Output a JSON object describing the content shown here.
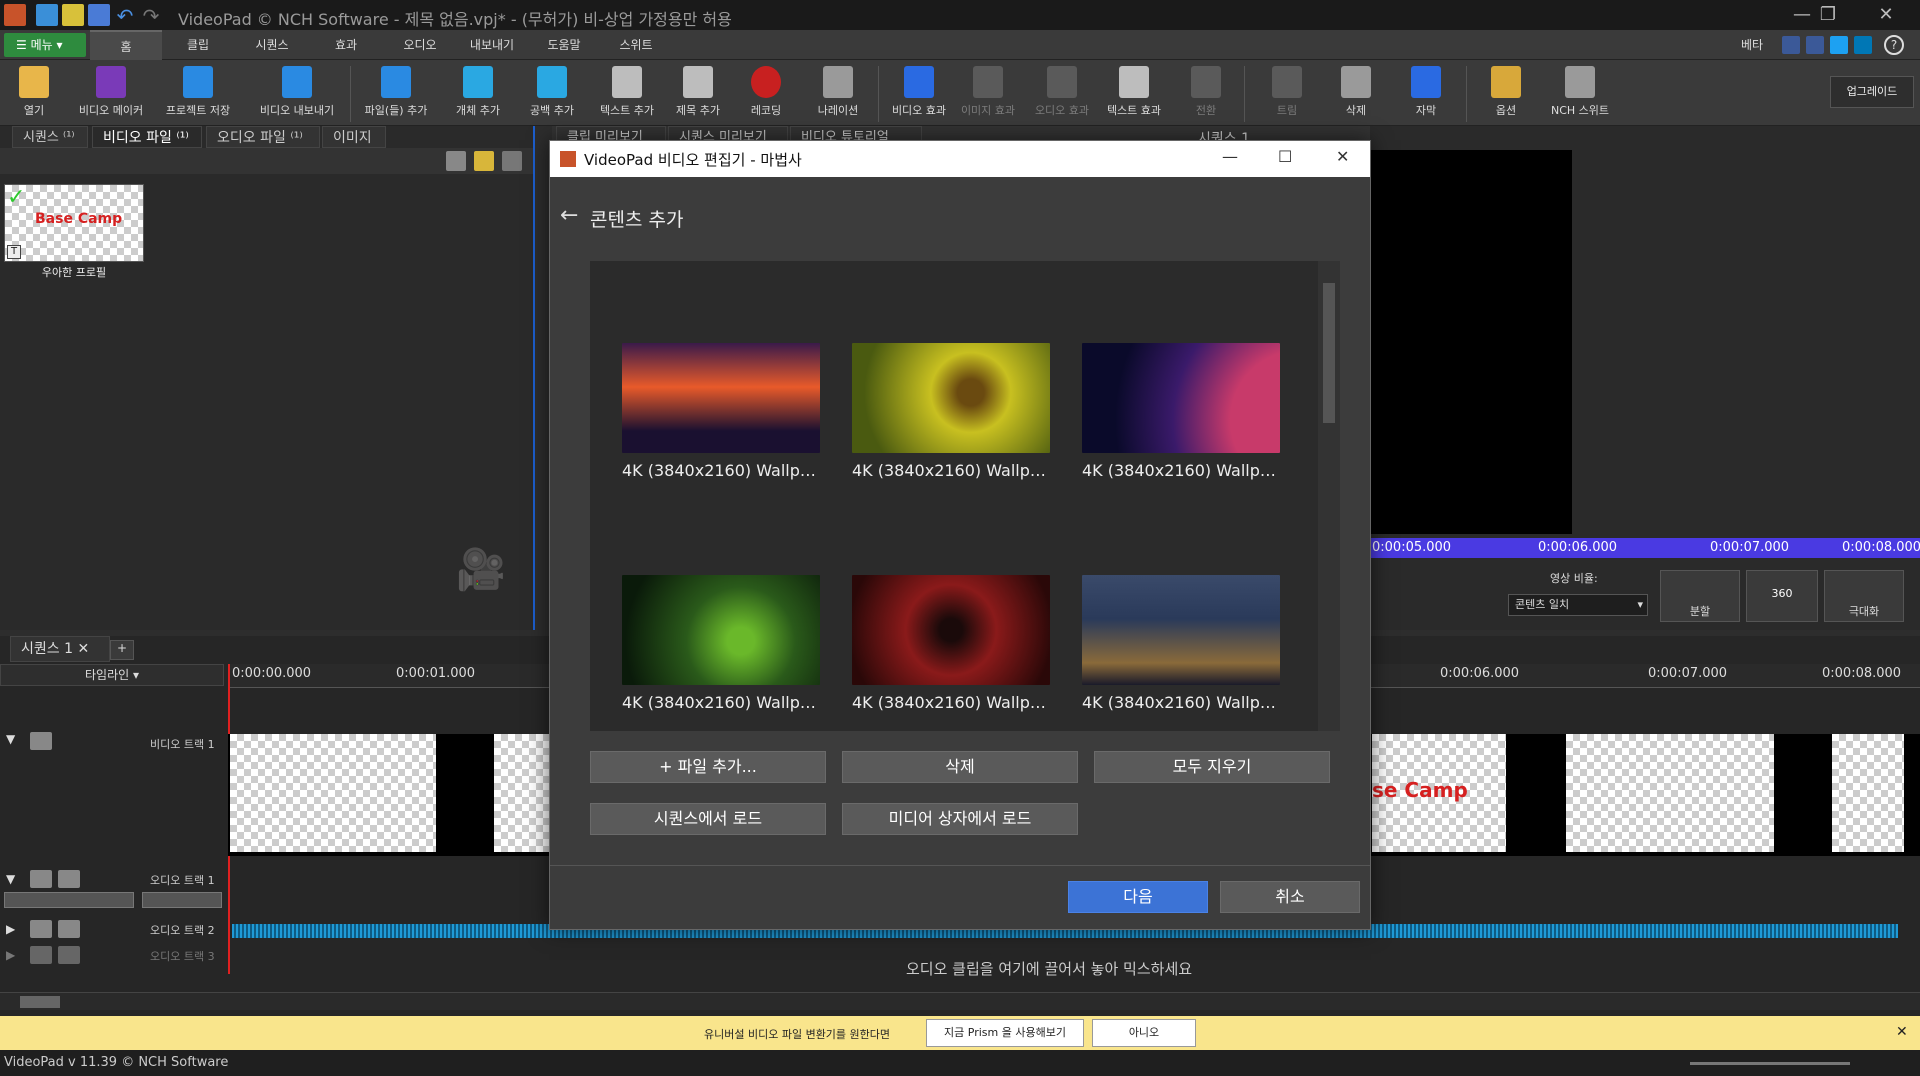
{
  "window": {
    "title": "VideoPad © NCH Software - 제목 없음.vpj* - (무허가) 비-상업 가정용만 허용",
    "minimize": "—",
    "restore": "❐",
    "close": "✕"
  },
  "tabs": {
    "menu": "메뉴",
    "items": [
      "홈",
      "클립",
      "시퀀스",
      "효과",
      "오디오",
      "내보내기",
      "도움말",
      "스위트"
    ],
    "beta": "베타"
  },
  "toolbar": {
    "items": [
      {
        "label": "열기",
        "icon": "open-folder-icon"
      },
      {
        "label": "비디오 메이커",
        "icon": "wizard-icon"
      },
      {
        "label": "프로젝트 저장",
        "icon": "save-icon"
      },
      {
        "label": "비디오 내보내기",
        "icon": "export-icon"
      },
      {
        "label": "파일(들) 추가",
        "icon": "add-files-icon"
      },
      {
        "label": "개체 추가",
        "icon": "add-object-icon"
      },
      {
        "label": "공백 추가",
        "icon": "add-blank-icon"
      },
      {
        "label": "텍스트 추가",
        "icon": "add-text-icon"
      },
      {
        "label": "제목 추가",
        "icon": "add-title-icon"
      },
      {
        "label": "레코딩",
        "icon": "record-icon"
      },
      {
        "label": "나레이션",
        "icon": "microphone-icon"
      },
      {
        "label": "비디오 효과",
        "icon": "video-fx-icon"
      },
      {
        "label": "이미지 효과",
        "icon": "image-fx-icon"
      },
      {
        "label": "오디오 효과",
        "icon": "audio-fx-icon"
      },
      {
        "label": "텍스트 효과",
        "icon": "text-fx-icon"
      },
      {
        "label": "전환",
        "icon": "transition-icon"
      },
      {
        "label": "트림",
        "icon": "trim-icon"
      },
      {
        "label": "삭제",
        "icon": "trash-icon"
      },
      {
        "label": "자막",
        "icon": "subtitle-icon"
      },
      {
        "label": "옵션",
        "icon": "options-icon"
      },
      {
        "label": "NCH 스위트",
        "icon": "nch-suite-icon"
      }
    ],
    "upgrade": "업그레이드"
  },
  "left_panel": {
    "tabs": [
      "시퀀스",
      "비디오 파일",
      "오디오 파일",
      "이미지"
    ],
    "tab_badges": [
      "⁽¹⁾",
      "⁽¹⁾",
      "⁽¹⁾",
      ""
    ],
    "clip_name": "우아한 프로필",
    "clip_logo": "Base Camp"
  },
  "preview_tabs": [
    "클립 미리보기",
    "시퀀스 미리보기",
    "비디오 튜토리얼"
  ],
  "sequence_label": "시퀀스 1",
  "preview": {
    "times": [
      "0:00:05.000",
      "0:00:06.000",
      "0:00:07.000",
      "0:00:08.000"
    ],
    "ratio_label": "영상 비율:",
    "ratio_value": "콘텐츠 일치",
    "split": "분할",
    "btn360": "360",
    "zoom": "극대화"
  },
  "dialog": {
    "title": "VideoPad 비디오 편집기 - 마법사",
    "heading": "콘텐츠 추가",
    "thumbs": [
      {
        "caption": "4K (3840x2160) Wallpape...",
        "color": "sunset"
      },
      {
        "caption": "4K (3840x2160) Wallpape...",
        "color": "bee"
      },
      {
        "caption": "4K (3840x2160) Wallpape...",
        "color": "space"
      },
      {
        "caption": "4K (3840x2160) Wallpape...",
        "color": "lizard"
      },
      {
        "caption": "4K (3840x2160) Wallpape...",
        "color": "spider"
      },
      {
        "caption": "4K (3840x2160) Wallpape...",
        "color": "city"
      }
    ],
    "buttons": {
      "add_file": "+ 파일 추가...",
      "delete": "삭제",
      "clear_all": "모두 지우기",
      "load_seq": "시퀀스에서 로드",
      "load_media": "미디어 상자에서 로드",
      "next": "다음",
      "cancel": "취소"
    }
  },
  "timeline": {
    "seq_tab": "시퀀스 1",
    "mode": "타임라인",
    "ruler": [
      "0:00:00.000",
      "0:00:01.000",
      "0:00:06.000",
      "0:00:07.000",
      "0:00:08.000"
    ],
    "tracks": {
      "video1": "비디오 트랙 1",
      "audio1": "오디오 트랙 1",
      "audio2": "오디오 트랙 2",
      "audio3": "오디오 트랙 3"
    },
    "drop_hint": "오디오 클립을 여기에 끌어서 놓아 믹스하세요",
    "clip_logo": "se Camp"
  },
  "notice": {
    "text": "유니버설 비디오 파일 변환기를 원한다면",
    "try": "지금 Prism 을 사용해보기",
    "no": "아니오"
  },
  "status": {
    "version": "VideoPad v 11.39 © NCH Software"
  }
}
